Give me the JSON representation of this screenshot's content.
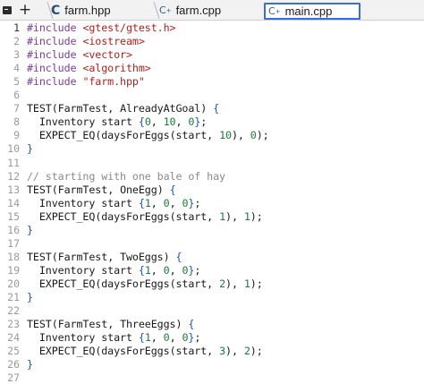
{
  "tabbar": {
    "terminal_icon": "terminal-icon",
    "new_tab_icon": "plus-icon",
    "new_tab_glyph": "+",
    "tabs": [
      {
        "label": "farm.hpp",
        "icon": "C",
        "icon_name": "c-header-icon",
        "active": false
      },
      {
        "label": "farm.cpp",
        "icon": "C",
        "icon_suffix": "+",
        "icon_name": "cpp-file-icon",
        "active": false
      },
      {
        "label": "main.cpp",
        "icon": "C",
        "icon_suffix": "+",
        "icon_name": "cpp-file-icon",
        "active": true
      }
    ]
  },
  "colors": {
    "preprocessor": "#7a3e9d",
    "string": "#b5201a",
    "number": "#1a7a3a",
    "comment": "#8a8a8a",
    "brace": "#1c52c4",
    "active_tab_border": "#3a6fd8"
  },
  "editor": {
    "lines": [
      {
        "n": "1",
        "active": true,
        "tokens": [
          [
            "pp",
            "#include "
          ],
          [
            "str",
            "<gtest/gtest.h>"
          ]
        ]
      },
      {
        "n": "2",
        "tokens": [
          [
            "pp",
            "#include "
          ],
          [
            "str",
            "<iostream>"
          ]
        ]
      },
      {
        "n": "3",
        "tokens": [
          [
            "pp",
            "#include "
          ],
          [
            "str",
            "<vector>"
          ]
        ]
      },
      {
        "n": "4",
        "tokens": [
          [
            "pp",
            "#include "
          ],
          [
            "str",
            "<algorithm>"
          ]
        ]
      },
      {
        "n": "5",
        "tokens": [
          [
            "pp",
            "#include "
          ],
          [
            "str",
            "\"farm.hpp\""
          ]
        ]
      },
      {
        "n": "6",
        "tokens": []
      },
      {
        "n": "7",
        "tokens": [
          [
            "kw",
            "TEST"
          ],
          [
            "paren",
            "("
          ],
          [
            "type",
            "FarmTest"
          ],
          [
            "br",
            ", "
          ],
          [
            "type",
            "AlreadyAtGoal"
          ],
          [
            "paren",
            ")"
          ],
          [
            "br",
            " "
          ],
          [
            "brace",
            "{"
          ]
        ]
      },
      {
        "n": "8",
        "tokens": [
          [
            "br",
            "  "
          ],
          [
            "type",
            "Inventory"
          ],
          [
            "br",
            " start "
          ],
          [
            "brace",
            "{"
          ],
          [
            "num",
            "0"
          ],
          [
            "br",
            ", "
          ],
          [
            "num",
            "10"
          ],
          [
            "br",
            ", "
          ],
          [
            "num",
            "0"
          ],
          [
            "brace",
            "}"
          ],
          [
            "br",
            ";"
          ]
        ]
      },
      {
        "n": "9",
        "tokens": [
          [
            "br",
            "  "
          ],
          [
            "kw",
            "EXPECT_EQ"
          ],
          [
            "paren",
            "("
          ],
          [
            "br",
            "daysForEggs"
          ],
          [
            "paren",
            "("
          ],
          [
            "br",
            "start, "
          ],
          [
            "num",
            "10"
          ],
          [
            "paren",
            ")"
          ],
          [
            "br",
            ", "
          ],
          [
            "num",
            "0"
          ],
          [
            "paren",
            ")"
          ],
          [
            "br",
            ";"
          ]
        ]
      },
      {
        "n": "10",
        "tokens": [
          [
            "brace",
            "}"
          ]
        ]
      },
      {
        "n": "11",
        "tokens": []
      },
      {
        "n": "12",
        "tokens": [
          [
            "cm",
            "// starting with one bale of hay"
          ]
        ]
      },
      {
        "n": "13",
        "tokens": [
          [
            "kw",
            "TEST"
          ],
          [
            "paren",
            "("
          ],
          [
            "type",
            "FarmTest"
          ],
          [
            "br",
            ", "
          ],
          [
            "type",
            "OneEgg"
          ],
          [
            "paren",
            ")"
          ],
          [
            "br",
            " "
          ],
          [
            "brace",
            "{"
          ]
        ]
      },
      {
        "n": "14",
        "tokens": [
          [
            "br",
            "  "
          ],
          [
            "type",
            "Inventory"
          ],
          [
            "br",
            " start "
          ],
          [
            "brace",
            "{"
          ],
          [
            "num",
            "1"
          ],
          [
            "br",
            ", "
          ],
          [
            "num",
            "0"
          ],
          [
            "br",
            ", "
          ],
          [
            "num",
            "0"
          ],
          [
            "brace",
            "}"
          ],
          [
            "br",
            ";"
          ]
        ]
      },
      {
        "n": "15",
        "tokens": [
          [
            "br",
            "  "
          ],
          [
            "kw",
            "EXPECT_EQ"
          ],
          [
            "paren",
            "("
          ],
          [
            "br",
            "daysForEggs"
          ],
          [
            "paren",
            "("
          ],
          [
            "br",
            "start, "
          ],
          [
            "num",
            "1"
          ],
          [
            "paren",
            ")"
          ],
          [
            "br",
            ", "
          ],
          [
            "num",
            "1"
          ],
          [
            "paren",
            ")"
          ],
          [
            "br",
            ";"
          ]
        ]
      },
      {
        "n": "16",
        "tokens": [
          [
            "brace",
            "}"
          ]
        ]
      },
      {
        "n": "17",
        "tokens": []
      },
      {
        "n": "18",
        "tokens": [
          [
            "kw",
            "TEST"
          ],
          [
            "paren",
            "("
          ],
          [
            "type",
            "FarmTest"
          ],
          [
            "br",
            ", "
          ],
          [
            "type",
            "TwoEggs"
          ],
          [
            "paren",
            ")"
          ],
          [
            "br",
            " "
          ],
          [
            "brace",
            "{"
          ]
        ]
      },
      {
        "n": "19",
        "tokens": [
          [
            "br",
            "  "
          ],
          [
            "type",
            "Inventory"
          ],
          [
            "br",
            " start "
          ],
          [
            "brace",
            "{"
          ],
          [
            "num",
            "1"
          ],
          [
            "br",
            ", "
          ],
          [
            "num",
            "0"
          ],
          [
            "br",
            ", "
          ],
          [
            "num",
            "0"
          ],
          [
            "brace",
            "}"
          ],
          [
            "br",
            ";"
          ]
        ]
      },
      {
        "n": "20",
        "tokens": [
          [
            "br",
            "  "
          ],
          [
            "kw",
            "EXPECT_EQ"
          ],
          [
            "paren",
            "("
          ],
          [
            "br",
            "daysForEggs"
          ],
          [
            "paren",
            "("
          ],
          [
            "br",
            "start, "
          ],
          [
            "num",
            "2"
          ],
          [
            "paren",
            ")"
          ],
          [
            "br",
            ", "
          ],
          [
            "num",
            "1"
          ],
          [
            "paren",
            ")"
          ],
          [
            "br",
            ";"
          ]
        ]
      },
      {
        "n": "21",
        "tokens": [
          [
            "brace",
            "}"
          ]
        ]
      },
      {
        "n": "22",
        "tokens": []
      },
      {
        "n": "23",
        "tokens": [
          [
            "kw",
            "TEST"
          ],
          [
            "paren",
            "("
          ],
          [
            "type",
            "FarmTest"
          ],
          [
            "br",
            ", "
          ],
          [
            "type",
            "ThreeEggs"
          ],
          [
            "paren",
            ")"
          ],
          [
            "br",
            " "
          ],
          [
            "brace",
            "{"
          ]
        ]
      },
      {
        "n": "24",
        "tokens": [
          [
            "br",
            "  "
          ],
          [
            "type",
            "Inventory"
          ],
          [
            "br",
            " start "
          ],
          [
            "brace",
            "{"
          ],
          [
            "num",
            "1"
          ],
          [
            "br",
            ", "
          ],
          [
            "num",
            "0"
          ],
          [
            "br",
            ", "
          ],
          [
            "num",
            "0"
          ],
          [
            "brace",
            "}"
          ],
          [
            "br",
            ";"
          ]
        ]
      },
      {
        "n": "25",
        "tokens": [
          [
            "br",
            "  "
          ],
          [
            "kw",
            "EXPECT_EQ"
          ],
          [
            "paren",
            "("
          ],
          [
            "br",
            "daysForEggs"
          ],
          [
            "paren",
            "("
          ],
          [
            "br",
            "start, "
          ],
          [
            "num",
            "3"
          ],
          [
            "paren",
            ")"
          ],
          [
            "br",
            ", "
          ],
          [
            "num",
            "2"
          ],
          [
            "paren",
            ")"
          ],
          [
            "br",
            ";"
          ]
        ]
      },
      {
        "n": "26",
        "tokens": [
          [
            "brace",
            "}"
          ]
        ]
      },
      {
        "n": "27",
        "tokens": []
      }
    ]
  }
}
